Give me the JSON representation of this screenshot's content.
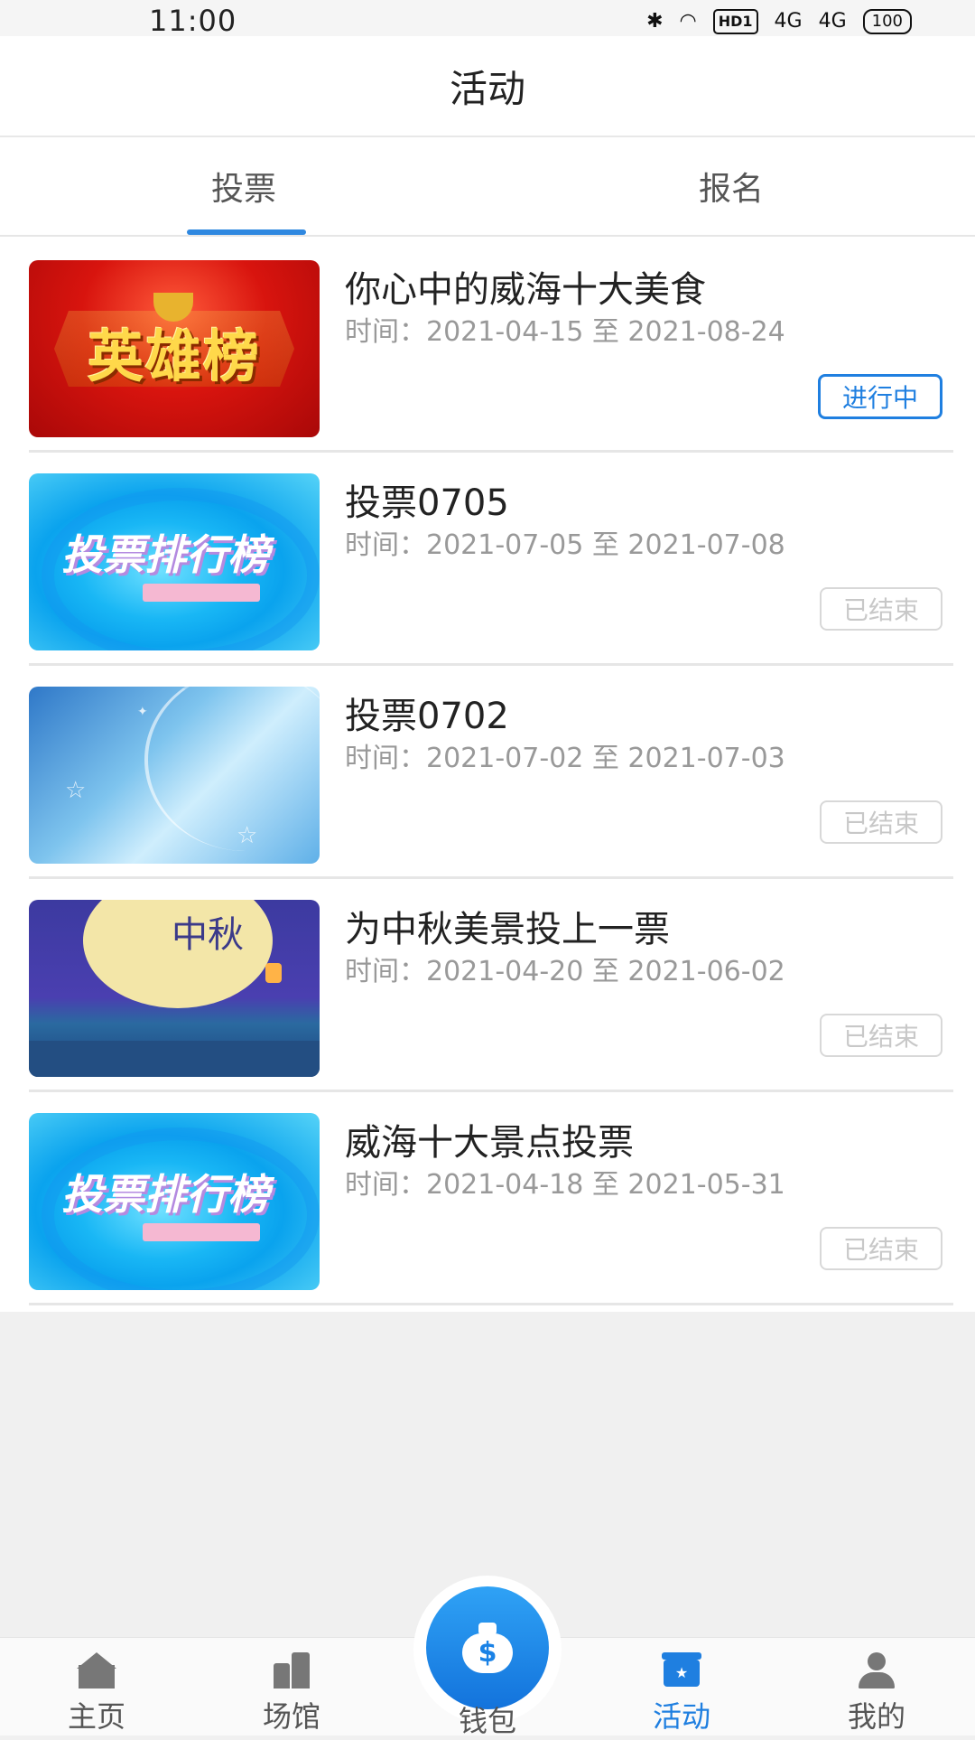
{
  "status_bar": {
    "time": "11:00",
    "icons": [
      "bluetooth-icon",
      "wifi-icon",
      "hd-icon",
      "signal-4g-icon",
      "signal-4g-icon",
      "battery-icon"
    ],
    "hd_label": "HD1",
    "network_1": "4G",
    "network_2": "4G",
    "battery": "100"
  },
  "header": {
    "title": "活动"
  },
  "tabs": [
    {
      "label": "投票",
      "active": true
    },
    {
      "label": "报名",
      "active": false
    }
  ],
  "accent_color": "#1f7fe0",
  "activities": [
    {
      "title": "你心中的威海十大美食",
      "time": "时间：2021-04-15 至 2021-08-24",
      "status": "进行中",
      "thumbnail": "英雄榜",
      "active": true
    },
    {
      "title": "投票0705",
      "time": "时间：2021-07-05 至 2021-07-08",
      "status": "已结束",
      "thumbnail": "投票排行榜",
      "active": false
    },
    {
      "title": "投票0702",
      "time": "时间：2021-07-02 至 2021-07-03",
      "status": "已结束",
      "thumbnail": "",
      "active": false
    },
    {
      "title": "为中秋美景投上一票",
      "time": "时间：2021-04-20 至 2021-06-02",
      "status": "已结束",
      "thumbnail": "中秋",
      "active": false
    },
    {
      "title": "威海十大景点投票",
      "time": "时间：2021-04-18 至 2021-05-31",
      "status": "已结束",
      "thumbnail": "投票排行榜",
      "active": false
    }
  ],
  "tab_bar": {
    "items": [
      {
        "label": "主页",
        "icon": "home-icon"
      },
      {
        "label": "场馆",
        "icon": "venue-icon"
      },
      {
        "label": "钱包",
        "icon": "wallet-icon"
      },
      {
        "label": "活动",
        "icon": "activity-icon",
        "active": true
      },
      {
        "label": "我的",
        "icon": "user-icon"
      }
    ]
  }
}
